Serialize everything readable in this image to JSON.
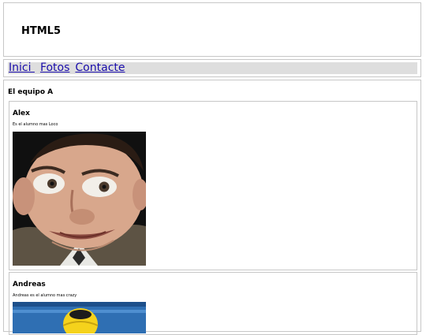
{
  "header": {
    "title": "HTML5"
  },
  "nav": {
    "items": [
      "Inici ",
      "Fotos",
      "Contacte"
    ]
  },
  "section": {
    "title": "El equipo A"
  },
  "members": [
    {
      "name": "Alex",
      "description": "Es el alumno mas Loco"
    },
    {
      "name": "Andreas",
      "description": "Andreas es el alumno mas crazy"
    }
  ]
}
